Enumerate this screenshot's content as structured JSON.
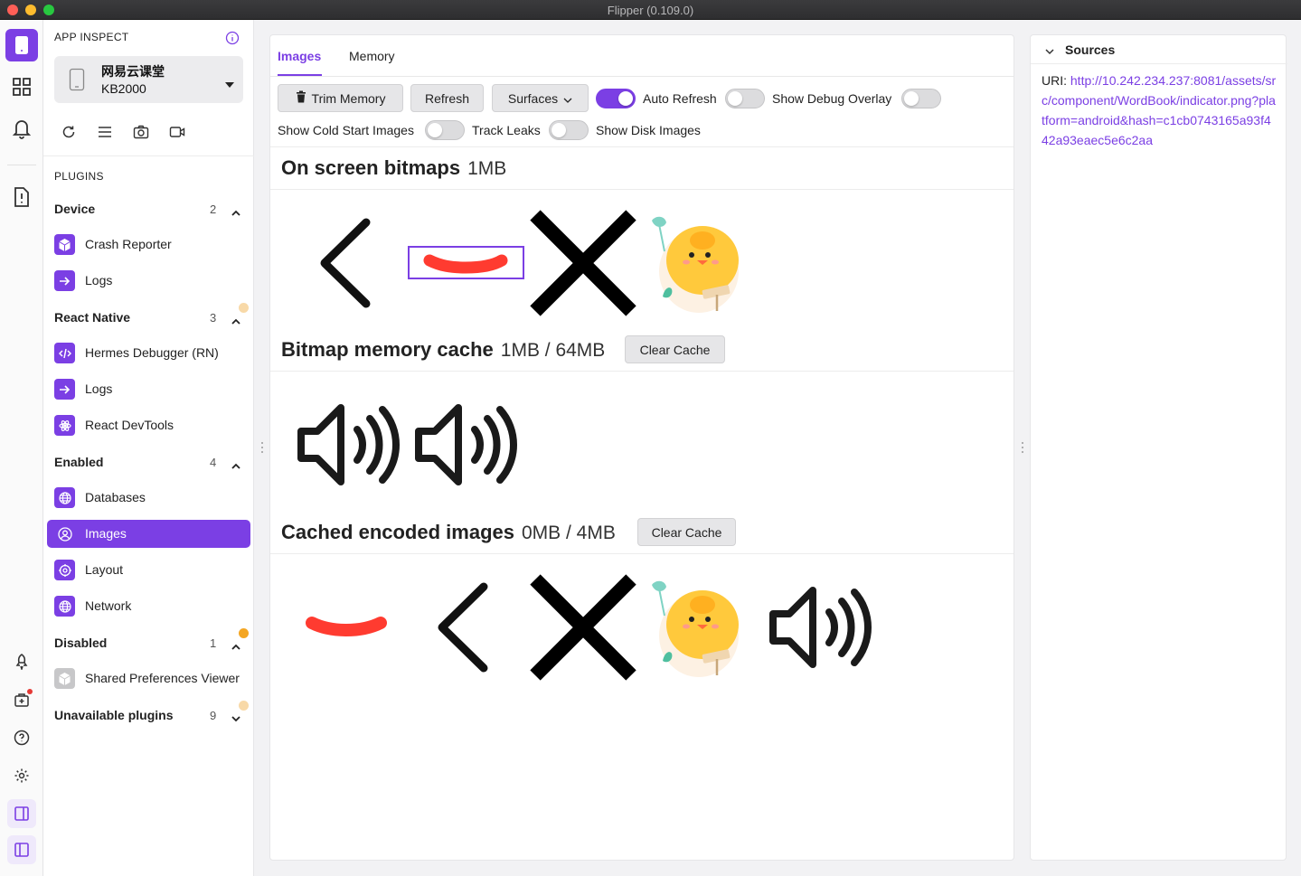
{
  "window": {
    "title": "Flipper (0.109.0)"
  },
  "colors": {
    "accent": "#7b3fe4",
    "red_dot": "#e53935",
    "orange_dot": "#f4a623",
    "faint_dot": "#f8d9a8"
  },
  "sidebar": {
    "app_inspect": "APP INSPECT",
    "device": {
      "name": "网易云课堂",
      "serial": "KB2000"
    },
    "plugins_label": "PLUGINS",
    "groups": [
      {
        "name": "Device",
        "count": "2",
        "items": [
          "Crash Reporter",
          "Logs"
        ]
      },
      {
        "name": "React Native",
        "count": "3",
        "items": [
          "Hermes Debugger (RN)",
          "Logs",
          "React DevTools"
        ]
      },
      {
        "name": "Enabled",
        "count": "4",
        "items": [
          "Databases",
          "Images",
          "Layout",
          "Network"
        ]
      },
      {
        "name": "Disabled",
        "count": "1",
        "items": [
          "Shared Preferences Viewer"
        ]
      },
      {
        "name": "Unavailable plugins",
        "count": "9",
        "items": []
      }
    ],
    "selected_item": "Images"
  },
  "main": {
    "tabs": [
      {
        "label": "Images",
        "active": true
      },
      {
        "label": "Memory",
        "active": false
      }
    ],
    "toolbar": {
      "trim_memory": "Trim Memory",
      "refresh": "Refresh",
      "surfaces": "Surfaces",
      "auto_refresh": "Auto Refresh",
      "show_debug_overlay": "Show Debug Overlay",
      "show_cold_start_images": "Show Cold Start Images",
      "track_leaks": "Track Leaks",
      "show_disk_images": "Show Disk Images"
    },
    "toggles": {
      "auto_refresh": true,
      "show_debug_overlay": false,
      "debug_overlay_extra": false,
      "show_cold_start_images": false,
      "track_leaks": false
    },
    "sections": [
      {
        "title": "On screen bitmaps",
        "size": "1MB"
      },
      {
        "title": "Bitmap memory cache",
        "size": "1MB / 64MB",
        "action": "Clear Cache"
      },
      {
        "title": "Cached encoded images",
        "size": "0MB / 4MB",
        "action": "Clear Cache"
      }
    ],
    "images": {
      "on_screen": [
        "back-chevron",
        "red-smile-selected",
        "close-x",
        "yellow-chick"
      ],
      "memory_cache": [
        "speaker",
        "speaker"
      ],
      "encoded": [
        "red-smile",
        "back-chevron",
        "close-x",
        "yellow-chick",
        "speaker"
      ]
    }
  },
  "sources": {
    "title": "Sources",
    "uri_label": "URI:",
    "uri": "http://10.242.234.237:8081/assets/src/component/WordBook/indicator.png?platform=android&hash=c1cb0743165a93f442a93eaec5e6c2aa"
  }
}
